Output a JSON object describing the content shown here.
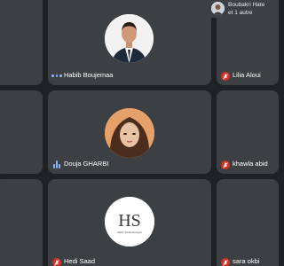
{
  "participants": [
    {
      "name": "Habib Boujemaa"
    },
    {
      "name": "Lilia Aloui"
    },
    {
      "name": "Douja GHARBI"
    },
    {
      "name": "khawla abid"
    },
    {
      "name": "Hedi Saad"
    },
    {
      "name": "sara okbi"
    }
  ],
  "toast": {
    "line1": "Boubakri Hate",
    "line2": "et 1 autre"
  },
  "logo": {
    "monogram": "HS",
    "subtitle": "HEDI SAAD Designs"
  },
  "colors": {
    "tile": "#3c4043",
    "background": "#202124",
    "muted": "#d93025",
    "speaking": "#8ab4f8"
  }
}
